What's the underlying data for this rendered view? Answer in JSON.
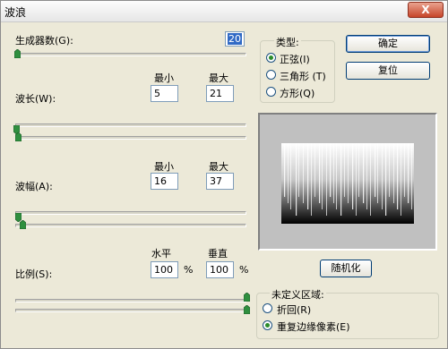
{
  "window": {
    "title": "波浪",
    "close_symbol": "X"
  },
  "generators": {
    "label": "生成器数(G):",
    "value": "20"
  },
  "wavelength": {
    "label": "波长(W):",
    "min_label": "最小",
    "max_label": "最大",
    "min": "5",
    "max": "21"
  },
  "amplitude": {
    "label": "波幅(A):",
    "min_label": "最小",
    "max_label": "最大",
    "min": "16",
    "max": "37"
  },
  "scale": {
    "label": "比例(S):",
    "h_label": "水平",
    "v_label": "垂直",
    "h": "100",
    "v": "100",
    "unit": "%"
  },
  "type_group": {
    "title": "类型:",
    "options": [
      "正弦(I)",
      "三角形 (T)",
      "方形(Q)"
    ],
    "selected": "正弦(I)"
  },
  "buttons": {
    "ok": "确定",
    "reset": "复位",
    "randomize": "随机化"
  },
  "undefined_group": {
    "title": "未定义区域:",
    "options": [
      "折回(R)",
      "重复边缘像素(E)"
    ],
    "selected": "重复边缘像素(E)"
  },
  "colors": {
    "accent": "#316ac5",
    "thumb": "#2f8f3f",
    "radio_dot": "#2b8c2b"
  },
  "icons": {
    "close": "close-icon",
    "slider_thumb": "slider-thumb-icon"
  }
}
